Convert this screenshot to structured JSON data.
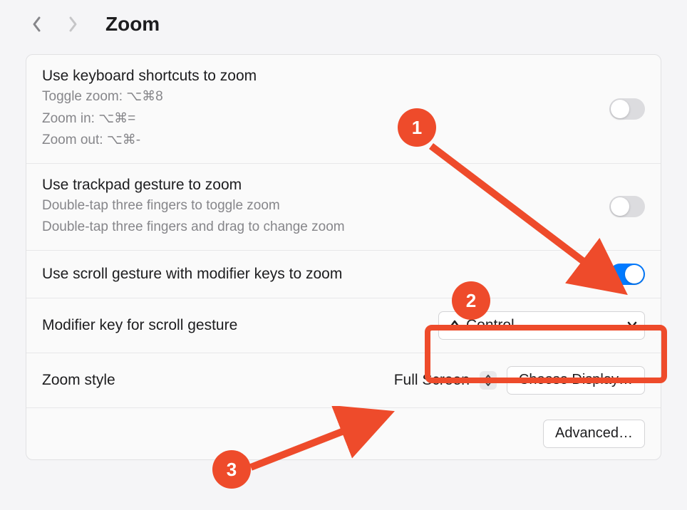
{
  "header": {
    "title": "Zoom"
  },
  "rows": {
    "keyboard": {
      "label": "Use keyboard shortcuts to zoom",
      "sub1": "Toggle zoom: ⌥⌘8",
      "sub2": "Zoom in: ⌥⌘=",
      "sub3": "Zoom out: ⌥⌘-",
      "enabled": false
    },
    "trackpad": {
      "label": "Use trackpad gesture to zoom",
      "sub1": "Double-tap three fingers to toggle zoom",
      "sub2": "Double-tap three fingers and drag to change zoom",
      "enabled": false
    },
    "scroll": {
      "label": "Use scroll gesture with modifier keys to zoom",
      "enabled": true
    },
    "modifier": {
      "label": "Modifier key for scroll gesture",
      "value": "Control"
    },
    "zoomstyle": {
      "label": "Zoom style",
      "value": "Full Screen",
      "choose_btn": "Choose Display…"
    }
  },
  "buttons": {
    "advanced": "Advanced…"
  },
  "annotations": {
    "a1": "1",
    "a2": "2",
    "a3": "3"
  }
}
